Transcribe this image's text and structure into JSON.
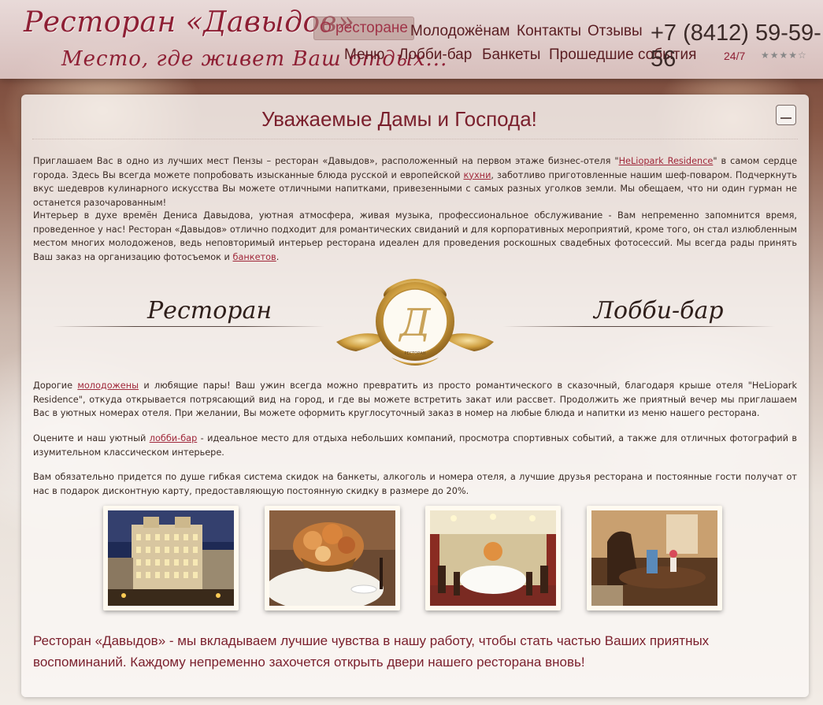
{
  "header": {
    "logo_title": "Ресторан «Давыдов»",
    "logo_tagline": "Место, где живет Ваш отдых...",
    "nav_row1": [
      "О ресторане",
      "Молодожёнам",
      "Контакты",
      "Отзывы"
    ],
    "nav_row2": [
      "Меню",
      "Лобби-бар",
      "Банкеты",
      "Прошедшие события"
    ],
    "active_nav": "О ресторане",
    "phone": "+7 (8412) 59-59-56",
    "hours": "24/7",
    "stars": "★★★★☆"
  },
  "main": {
    "title": "Уважаемые Дамы и Господа!",
    "p1_a": "Приглашаем Вас в одно из лучших мест Пензы – ресторан «Давыдов», расположенный на первом этаже бизнес-отеля \"",
    "p1_link1": "HeLiopark Residence",
    "p1_b": "\" в самом сердце города. Здесь Вы всегда можете попробовать изысканные блюда русской и европейской ",
    "p1_link2": "кухни",
    "p1_c": ", заботливо приготовленные нашим шеф-поваром. Подчеркнуть вкус шедевров кулинарного искусства Вы можете отличными напитками, привезенными с самых разных уголков земли. Мы обещаем, что ни один гурман не останется разочарованным!",
    "p2_a": "Интерьер в духе времён Дениса Давыдова, уютная атмосфера, живая музыка, профессиональное обслуживание - Вам непременно запомнится время, проведенное у нас! Ресторан «Давыдов» отлично подходит для романтических свиданий и для корпоративных мероприятий, кроме того, он стал излюбленным местом многих молодоженов, ведь неповторимый интерьер ресторана идеален для проведения роскошных свадебных фотосессий. Мы всегда рады принять Ваш заказ на организацию фотосъемок и ",
    "p2_link": "банкетов",
    "p2_b": ".",
    "section_left": "Ресторан",
    "section_right": "Лобби-бар",
    "emblem_letter": "Д",
    "emblem_caption": "РЕСТОРАН",
    "p3_a": "Дорогие ",
    "p3_link": "молодожены",
    "p3_b": " и любящие пары! Ваш ужин всегда можно превратить из просто романтического в сказочный, благодаря крыше отеля \"HeLiopark Residence\", откуда открывается потрясающий вид на город, и где вы можете встретить закат или рассвет. Продолжить же приятный вечер мы приглашаем Вас в уютных номерах отеля. При желании, Вы можете оформить круглосуточный заказ в номер на любые блюда и напитки из меню нашего ресторана.",
    "p4_a": "Оцените и наш уютный ",
    "p4_link": "лобби-бар",
    "p4_b": " - идеальное место для отдыха небольших компаний, просмотра спортивных событий, а также для отличных фотографий в изумительном классическом интерьере.",
    "p5": "Вам обязательно придется по душе гибкая система скидок на банкеты, алкоголь и номера отеля, а лучшие друзья ресторана и постоянные гости получат от нас в подарок дисконтную карту, предоставляющую постоянную скидку в размере до 20%.",
    "closing": "Ресторан «Давыдов» - мы вкладываем лучшие чувства в нашу работу, чтобы стать частью Ваших приятных воспоминаний. Каждому непременно захочется открыть двери нашего ресторана вновь!"
  },
  "colors": {
    "brand": "#8e1f34",
    "link": "#a0283a",
    "gold": "#c99a3a"
  }
}
